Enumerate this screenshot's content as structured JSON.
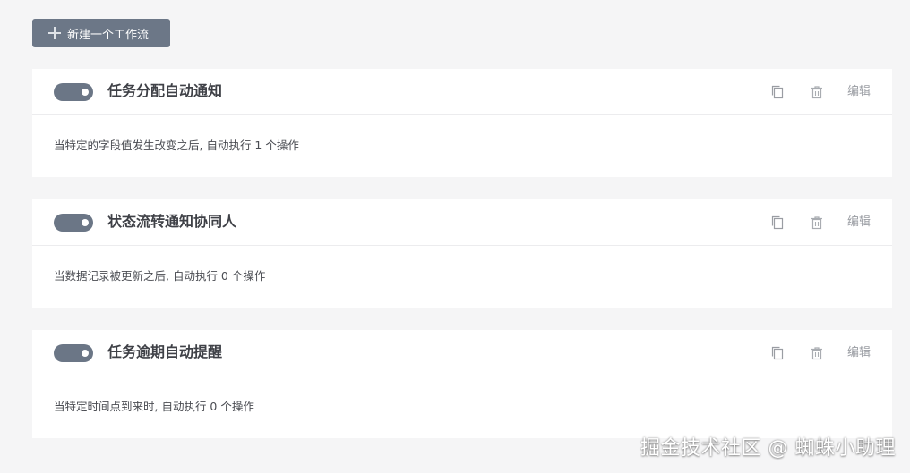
{
  "toolbar": {
    "new_workflow_label": "新建一个工作流"
  },
  "workflows": [
    {
      "enabled": true,
      "title": "任务分配自动通知",
      "description": "当特定的字段值发生改变之后, 自动执行 1 个操作",
      "edit_label": "编辑"
    },
    {
      "enabled": true,
      "title": "状态流转通知协同人",
      "description": "当数据记录被更新之后, 自动执行 0 个操作",
      "edit_label": "编辑"
    },
    {
      "enabled": true,
      "title": "任务逾期自动提醒",
      "description": "当特定时间点到来时, 自动执行 0 个操作",
      "edit_label": "编辑"
    }
  ],
  "icons": {
    "new": "plus-icon",
    "copy": "copy-icon",
    "delete": "trash-icon"
  },
  "colors": {
    "page_background": "#f5f5f6",
    "button_background": "#6c7787",
    "toggle_on": "#6b7686",
    "card_background": "#ffffff",
    "action_gray": "#9a9da3"
  },
  "watermark": "掘金技术社区 @ 蜘蛛小助理"
}
